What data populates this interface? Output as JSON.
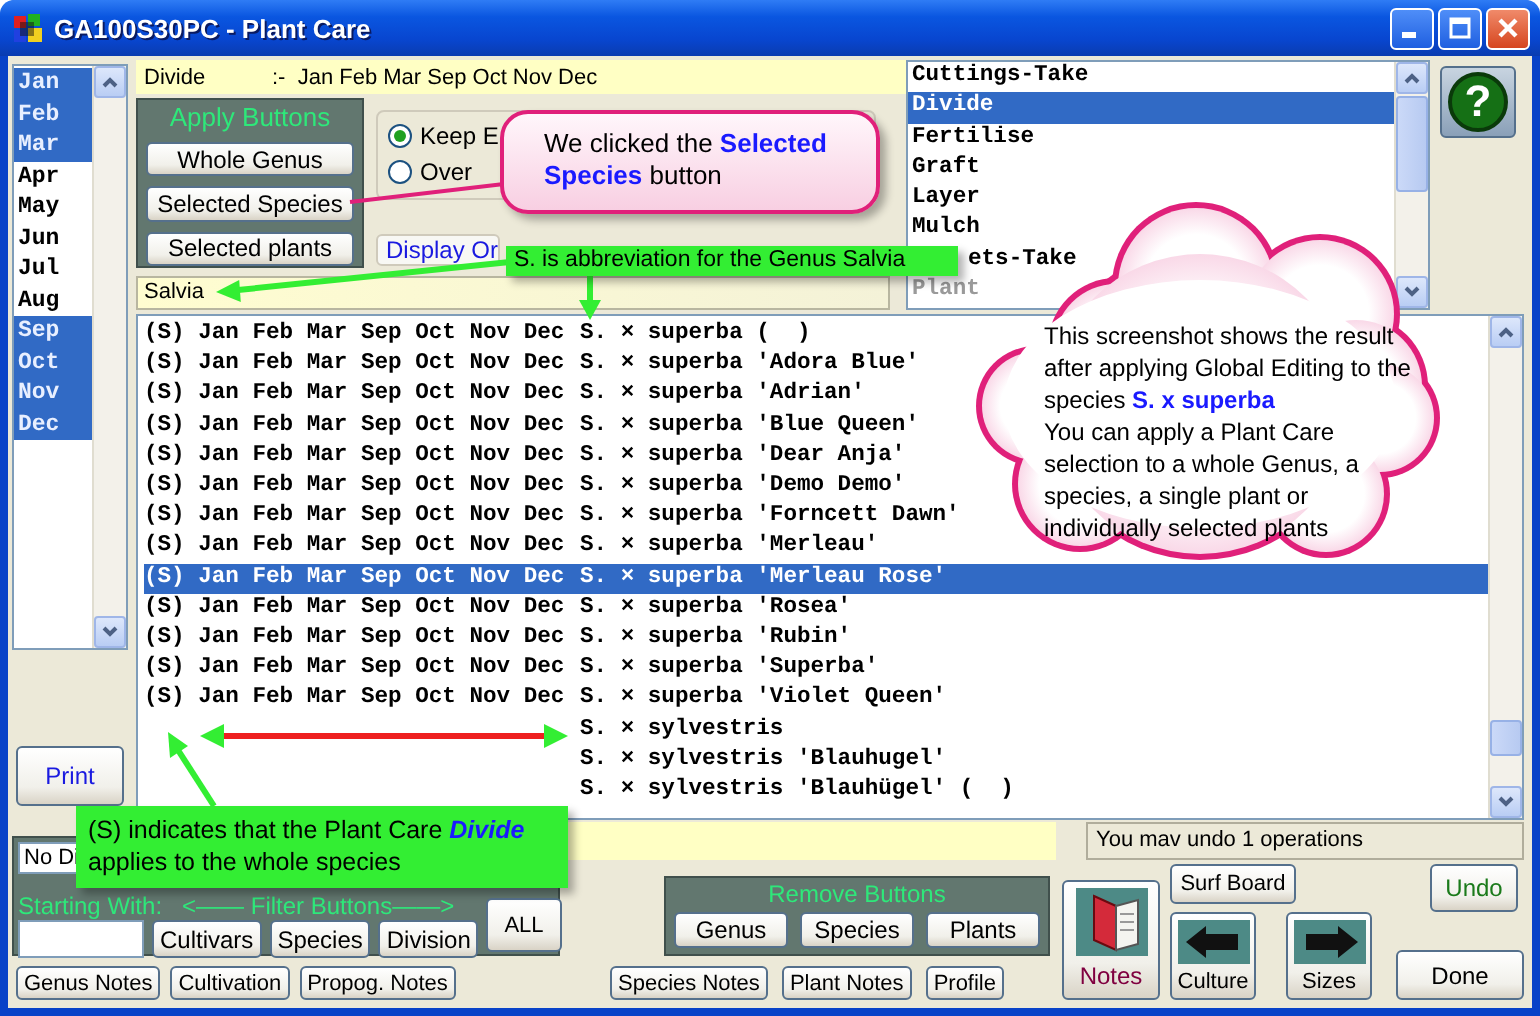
{
  "window": {
    "title": "GA100S30PC - Plant Care"
  },
  "months": [
    {
      "label": "Jan",
      "selected": true
    },
    {
      "label": "Feb",
      "selected": true
    },
    {
      "label": "Mar",
      "selected": true
    },
    {
      "label": "Apr",
      "selected": false
    },
    {
      "label": "May",
      "selected": false
    },
    {
      "label": "Jun",
      "selected": false
    },
    {
      "label": "Jul",
      "selected": false
    },
    {
      "label": "Aug",
      "selected": false
    },
    {
      "label": "Sep",
      "selected": true
    },
    {
      "label": "Oct",
      "selected": true
    },
    {
      "label": "Nov",
      "selected": true
    },
    {
      "label": "Dec",
      "selected": true
    }
  ],
  "print_button": "Print",
  "care_summary": {
    "task": "Divide",
    "months": ":-  Jan Feb Mar Sep Oct Nov Dec"
  },
  "apply_panel": {
    "title": "Apply Buttons",
    "buttons": [
      "Whole Genus",
      "Selected Species",
      "Selected plants"
    ]
  },
  "options": [
    {
      "label": "Keep E",
      "selected": true
    },
    {
      "label": "Over",
      "selected": false
    }
  ],
  "display_order": "Display Or",
  "care_tasks": [
    {
      "label": "Cuttings-Take",
      "selected": false,
      "disabled": false
    },
    {
      "label": "Divide",
      "selected": true,
      "disabled": false
    },
    {
      "label": "Fertilise",
      "selected": false,
      "disabled": false
    },
    {
      "label": "Graft",
      "selected": false,
      "disabled": false
    },
    {
      "label": "Layer",
      "selected": false,
      "disabled": false
    },
    {
      "label": "Mulch",
      "selected": false,
      "disabled": false
    },
    {
      "label": "ets-Take",
      "selected": false,
      "disabled": false
    },
    {
      "label": "Plant",
      "selected": false,
      "disabled": true
    }
  ],
  "help_button": "?",
  "genus_field": {
    "value": "Salvia"
  },
  "plants": [
    {
      "care": "(S) Jan Feb Mar Sep Oct Nov Dec",
      "name": "S. × superba (  )",
      "selected": false
    },
    {
      "care": "(S) Jan Feb Mar Sep Oct Nov Dec",
      "name": "S. × superba 'Adora Blue'",
      "selected": false
    },
    {
      "care": "(S) Jan Feb Mar Sep Oct Nov Dec",
      "name": "S. × superba 'Adrian'",
      "selected": false
    },
    {
      "care": "(S) Jan Feb Mar Sep Oct Nov Dec",
      "name": "S. × superba 'Blue Queen'",
      "selected": false
    },
    {
      "care": "(S) Jan Feb Mar Sep Oct Nov Dec",
      "name": "S. × superba 'Dear Anja'",
      "selected": false
    },
    {
      "care": "(S) Jan Feb Mar Sep Oct Nov Dec",
      "name": "S. × superba 'Demo Demo'",
      "selected": false
    },
    {
      "care": "(S) Jan Feb Mar Sep Oct Nov Dec",
      "name": "S. × superba 'Forncett Dawn'",
      "selected": false
    },
    {
      "care": "(S) Jan Feb Mar Sep Oct Nov Dec",
      "name": "S. × superba 'Merleau'",
      "selected": false
    },
    {
      "care": "(S) Jan Feb Mar Sep Oct Nov Dec",
      "name": "S. × superba 'Merleau Rose'",
      "selected": true
    },
    {
      "care": "(S) Jan Feb Mar Sep Oct Nov Dec",
      "name": "S. × superba 'Rosea'",
      "selected": false
    },
    {
      "care": "(S) Jan Feb Mar Sep Oct Nov Dec",
      "name": "S. × superba 'Rubin'",
      "selected": false
    },
    {
      "care": "(S) Jan Feb Mar Sep Oct Nov Dec",
      "name": "S. × superba 'Superba'",
      "selected": false
    },
    {
      "care": "(S) Jan Feb Mar Sep Oct Nov Dec",
      "name": "S. × superba 'Violet Queen'",
      "selected": false
    },
    {
      "name": "S. × sylvestris",
      "selected": false
    },
    {
      "name": "S. × sylvestris 'Blauhugel'",
      "selected": false
    },
    {
      "name": "S. × sylvestris 'Blauhügel' (  )",
      "selected": false
    }
  ],
  "filter_panel": {
    "display_field": "No Di",
    "starting_with": "Starting With:",
    "caption": "<—— Filter Buttons——>",
    "buttons": [
      "Cultivars",
      "Species",
      "Division"
    ],
    "all_button": "ALL"
  },
  "notes_buttons_left": [
    "Genus Notes",
    "Cultivation",
    "Propog. Notes"
  ],
  "status": "You mav undo 1 operations",
  "remove_panel": {
    "title": "Remove Buttons",
    "buttons": [
      "Genus",
      "Species",
      "Plants"
    ]
  },
  "notes_buttons_mid": [
    "Species Notes",
    "Plant Notes",
    "Profile"
  ],
  "surf_board": "Surf Board",
  "tools": [
    {
      "label": "Notes",
      "kind": "book"
    },
    {
      "label": "Culture",
      "kind": "back"
    },
    {
      "label": "Sizes",
      "kind": "forward"
    }
  ],
  "undo_button": "Undo",
  "done_button": "Done",
  "callouts": [
    {
      "kind": "bubble",
      "text": "We clicked the **Selected Species** button"
    },
    {
      "kind": "label",
      "text": "S. is abbreviation for the Genus Salvia"
    },
    {
      "kind": "cloud",
      "paragraphs": [
        "This screenshot shows the result after applying Global Editing to the species **S. x superba**",
        "You can apply a Plant Care selection to a whole Genus, a species, a single plant or individually selected plants"
      ]
    },
    {
      "kind": "label",
      "text": "(S) indicates that the Plant Care *Divide* applies to the whole species"
    }
  ]
}
